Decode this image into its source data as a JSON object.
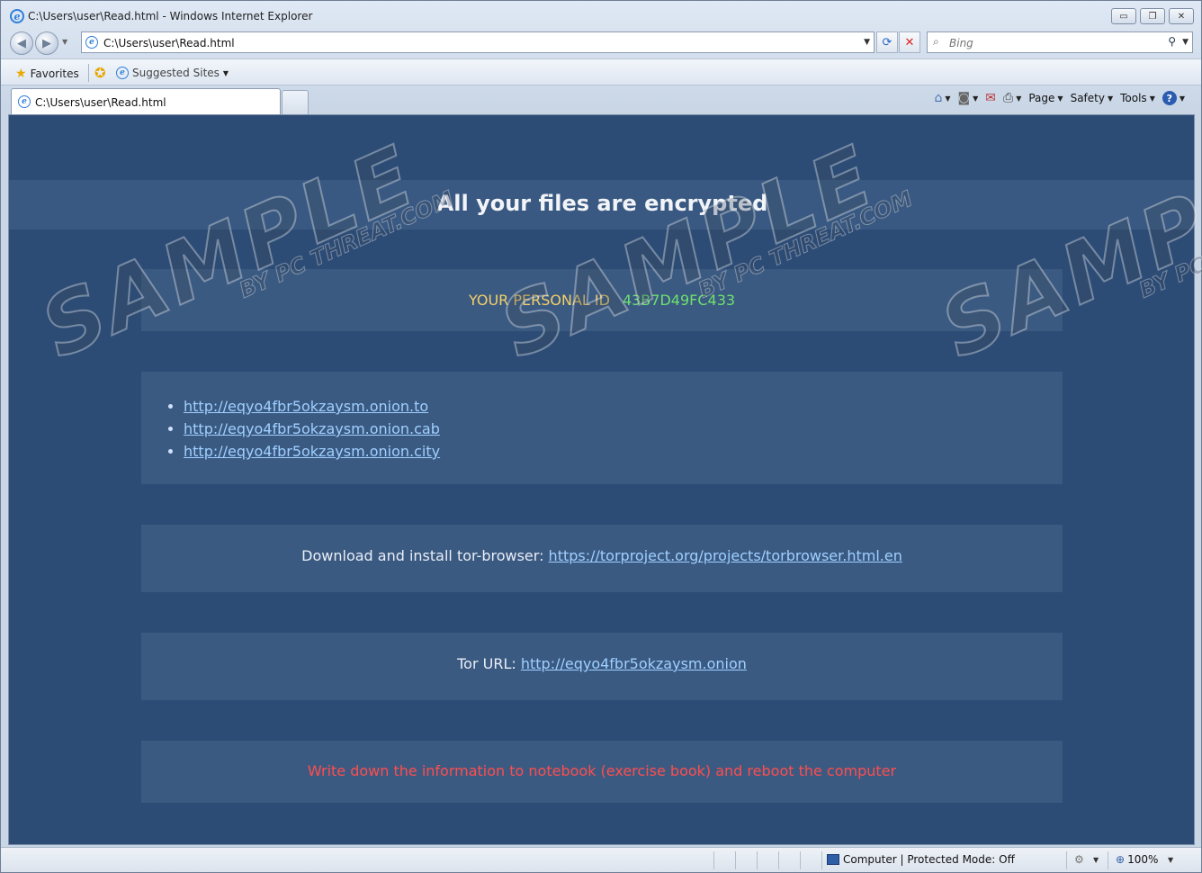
{
  "window": {
    "title": "C:\\Users\\user\\Read.html - Windows Internet Explorer",
    "buttons": {
      "minimize": "▭",
      "restore": "❐",
      "close": "✕"
    }
  },
  "address": {
    "url": "C:\\Users\\user\\Read.html",
    "search_placeholder": "Bing"
  },
  "favorites": {
    "favorites_label": "Favorites",
    "suggested_label": "Suggested Sites"
  },
  "tab": {
    "label": "C:\\Users\\user\\Read.html"
  },
  "commands": {
    "page": "Page",
    "safety": "Safety",
    "tools": "Tools"
  },
  "content": {
    "headline": "All your files are encrypted",
    "id_label": "YOUR PERSONAL ID",
    "id_value": "43B7D49FC433",
    "links": [
      "http://eqyo4fbr5okzaysm.onion.to",
      "http://eqyo4fbr5okzaysm.onion.cab",
      "http://eqyo4fbr5okzaysm.onion.city"
    ],
    "tor_text": "Download and install tor-browser: ",
    "tor_link": "https://torproject.org/projects/torbrowser.html.en",
    "tor_url_text": "Tor URL: ",
    "tor_url_link": "http://eqyo4fbr5okzaysm.onion",
    "note": "Write down the information to notebook (exercise book) and reboot the computer"
  },
  "watermark": {
    "big": "SAMPLE",
    "small": "BY PC THREAT.COM"
  },
  "status": {
    "zone": "Computer | Protected Mode: Off",
    "zoom": "100%"
  },
  "colors": {
    "page_bg": "#2c4b75",
    "panel_bg": "#3b5a82",
    "id_label": "#f4cf66",
    "id_value": "#6fe06f",
    "link": "#9fd0ff",
    "note": "#ff4d4d"
  }
}
